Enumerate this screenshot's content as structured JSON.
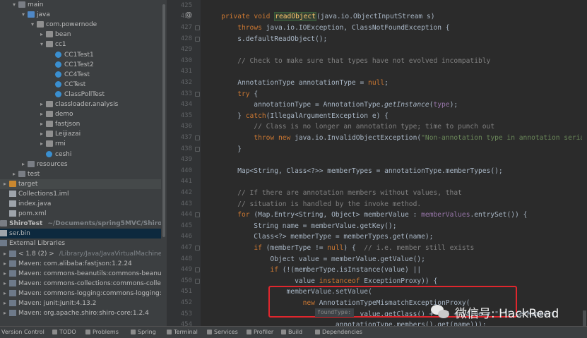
{
  "project_tree": [
    {
      "label": "main",
      "depth": 1,
      "arrow": "v",
      "icon": "folder"
    },
    {
      "label": "java",
      "depth": 2,
      "arrow": "v",
      "icon": "folder-blue"
    },
    {
      "label": "com.powernode",
      "depth": 3,
      "arrow": "v",
      "icon": "pkg"
    },
    {
      "label": "bean",
      "depth": 4,
      "arrow": ">",
      "icon": "pkg"
    },
    {
      "label": "cc1",
      "depth": 4,
      "arrow": "v",
      "icon": "pkg"
    },
    {
      "label": "CC1Test1",
      "depth": 5,
      "arrow": "",
      "icon": "cls"
    },
    {
      "label": "CC1Test2",
      "depth": 5,
      "arrow": "",
      "icon": "cls"
    },
    {
      "label": "CC4Test",
      "depth": 5,
      "arrow": "",
      "icon": "cls"
    },
    {
      "label": "CCTest",
      "depth": 5,
      "arrow": "",
      "icon": "cls"
    },
    {
      "label": "ClassPollTest",
      "depth": 5,
      "arrow": "",
      "icon": "cls"
    },
    {
      "label": "classloader.analysis",
      "depth": 4,
      "arrow": ">",
      "icon": "pkg"
    },
    {
      "label": "demo",
      "depth": 4,
      "arrow": ">",
      "icon": "pkg"
    },
    {
      "label": "fastjson",
      "depth": 4,
      "arrow": ">",
      "icon": "pkg"
    },
    {
      "label": "Leijiazai",
      "depth": 4,
      "arrow": ">",
      "icon": "pkg"
    },
    {
      "label": "rmi",
      "depth": 4,
      "arrow": ">",
      "icon": "pkg"
    },
    {
      "label": "ceshi",
      "depth": 4,
      "arrow": "",
      "icon": "cls"
    },
    {
      "label": "resources",
      "depth": 2,
      "arrow": ">",
      "icon": "folder"
    },
    {
      "label": "test",
      "depth": 1,
      "arrow": ">",
      "icon": "folder"
    },
    {
      "label": "target",
      "depth": 0,
      "arrow": ">",
      "icon": "folder-orange",
      "state": "highlight"
    },
    {
      "label": "Collections1.iml",
      "depth": 0,
      "arrow": "",
      "icon": "file"
    },
    {
      "label": "index.java",
      "depth": 0,
      "arrow": "",
      "icon": "file"
    },
    {
      "label": "pom.xml",
      "depth": 0,
      "arrow": "",
      "icon": "file"
    },
    {
      "label": "ShiroTest",
      "suffix": "~/Documents/spring5MVC/ShiroTest",
      "depth": -1,
      "arrow": ">",
      "icon": "folder"
    },
    {
      "label": "ser.bin",
      "depth": -1,
      "arrow": "",
      "icon": "file",
      "state": "selected"
    },
    {
      "label": "External Libraries",
      "depth": -1,
      "arrow": "v",
      "icon": "lib"
    },
    {
      "label": "< 1.8 (2) >",
      "suffix": "/Library/Java/JavaVirtualMachines/jd",
      "depth": 0,
      "arrow": ">",
      "icon": "lib"
    },
    {
      "label": "Maven: com.alibaba:fastjson:1.2.24",
      "depth": 0,
      "arrow": ">",
      "icon": "lib"
    },
    {
      "label": "Maven: commons-beanutils:commons-beanutil",
      "depth": 0,
      "arrow": ">",
      "icon": "lib"
    },
    {
      "label": "Maven: commons-collections:commons-collect",
      "depth": 0,
      "arrow": ">",
      "icon": "lib"
    },
    {
      "label": "Maven: commons-logging:commons-logging:1.",
      "depth": 0,
      "arrow": ">",
      "icon": "lib"
    },
    {
      "label": "Maven: junit:junit:4.13.2",
      "depth": 0,
      "arrow": ">",
      "icon": "lib"
    },
    {
      "label": "Maven: org.apache.shiro:shiro-core:1.2.4",
      "depth": 0,
      "arrow": ">",
      "icon": "lib"
    }
  ],
  "line_numbers": [
    "425",
    "426",
    "427",
    "428",
    "429",
    "430",
    "431",
    "432",
    "433",
    "434",
    "435",
    "436",
    "437",
    "438",
    "439",
    "440",
    "441",
    "442",
    "443",
    "444",
    "445",
    "446",
    "447",
    "448",
    "449",
    "450",
    "451",
    "452",
    "453",
    "454"
  ],
  "code_lines": [
    [],
    [
      {
        "t": "    "
      },
      {
        "t": "private ",
        "c": "kw"
      },
      {
        "t": "void ",
        "c": "kw"
      },
      {
        "t": "readObject",
        "c": "mth sel-word"
      },
      {
        "t": "(java.io.ObjectInputStream s)"
      }
    ],
    [
      {
        "t": "        "
      },
      {
        "t": "throws ",
        "c": "kw"
      },
      {
        "t": "java.io.IOException, ClassNotFoundException {"
      }
    ],
    [
      {
        "t": "        s.defaultReadObject();"
      }
    ],
    [],
    [
      {
        "t": "        // Check to make sure that types have not evolved incompatibly",
        "c": "cmt"
      }
    ],
    [],
    [
      {
        "t": "        AnnotationType annotationType = "
      },
      {
        "t": "null",
        "c": "kw"
      },
      {
        "t": ";"
      }
    ],
    [
      {
        "t": "        "
      },
      {
        "t": "try ",
        "c": "kw"
      },
      {
        "t": "{"
      }
    ],
    [
      {
        "t": "            annotationType = AnnotationType."
      },
      {
        "t": "getInstance",
        "c": "ital"
      },
      {
        "t": "("
      },
      {
        "t": "type",
        "c": "fld"
      },
      {
        "t": ");"
      }
    ],
    [
      {
        "t": "        } "
      },
      {
        "t": "catch",
        "c": "kw"
      },
      {
        "t": "(IllegalArgumentException e) {"
      }
    ],
    [
      {
        "t": "            // Class is no longer an annotation type; time to punch out",
        "c": "cmt"
      }
    ],
    [
      {
        "t": "            "
      },
      {
        "t": "throw new ",
        "c": "kw"
      },
      {
        "t": "java.io.InvalidObjectException("
      },
      {
        "t": "\"Non-annotation type in annotation serial s",
        "c": "str"
      }
    ],
    [
      {
        "t": "        }"
      }
    ],
    [],
    [
      {
        "t": "        Map<String, Class<?>> memberTypes = annotationType.memberTypes();"
      }
    ],
    [],
    [
      {
        "t": "        // If there are annotation members without values, that",
        "c": "cmt"
      }
    ],
    [
      {
        "t": "        // situation is handled by the invoke method.",
        "c": "cmt"
      }
    ],
    [
      {
        "t": "        "
      },
      {
        "t": "for ",
        "c": "kw"
      },
      {
        "t": "(Map.Entry<String, Object> memberValue : "
      },
      {
        "t": "memberValues",
        "c": "fld"
      },
      {
        "t": ".entrySet()) {"
      }
    ],
    [
      {
        "t": "            String name = memberValue.getKey();"
      }
    ],
    [
      {
        "t": "            Class<?> memberType = memberTypes.get(name);"
      }
    ],
    [
      {
        "t": "            "
      },
      {
        "t": "if ",
        "c": "kw"
      },
      {
        "t": "(memberType != "
      },
      {
        "t": "null",
        "c": "kw"
      },
      {
        "t": ") {  "
      },
      {
        "t": "// i.e. member still exists",
        "c": "cmt"
      }
    ],
    [
      {
        "t": "                Object value = memberValue.getValue();"
      }
    ],
    [
      {
        "t": "                "
      },
      {
        "t": "if ",
        "c": "kw"
      },
      {
        "t": "(!(memberType.isInstance(value) ||"
      }
    ],
    [
      {
        "t": "                      value "
      },
      {
        "t": "instanceof ",
        "c": "kw"
      },
      {
        "t": "ExceptionProxy)) {"
      }
    ],
    [
      {
        "t": "                    memberValue.setValue("
      }
    ],
    [
      {
        "t": "                        "
      },
      {
        "t": "new ",
        "c": "kw"
      },
      {
        "t": "AnnotationTypeMismatchExceptionProxy("
      }
    ],
    [
      {
        "t": "                                      value.getClass() + \"[\" + value + \"]\").setMember("
      }
    ],
    [
      {
        "t": "                                annotationType.members().get(name)));"
      }
    ]
  ],
  "tooltip_text": "foundType:",
  "watermark_text": "微信号: HackRead",
  "status_bar": [
    {
      "label": "Version Control",
      "icon": "version-control-icon"
    },
    {
      "label": "TODO",
      "icon": "todo-icon"
    },
    {
      "label": "Problems",
      "icon": "problems-icon"
    },
    {
      "label": "Spring",
      "icon": "spring-icon"
    },
    {
      "label": "Terminal",
      "icon": "terminal-icon"
    },
    {
      "label": "Services",
      "icon": "services-icon"
    },
    {
      "label": "Profiler",
      "icon": "profiler-icon"
    },
    {
      "label": "Build",
      "icon": "build-icon"
    },
    {
      "label": "Dependencies",
      "icon": "dependencies-icon"
    }
  ],
  "colors": {
    "keyword": "#cc7832",
    "method": "#ffc66d",
    "comment": "#808080",
    "string": "#6a8759",
    "field": "#9876aa",
    "annotation_box": "#e0262d"
  }
}
